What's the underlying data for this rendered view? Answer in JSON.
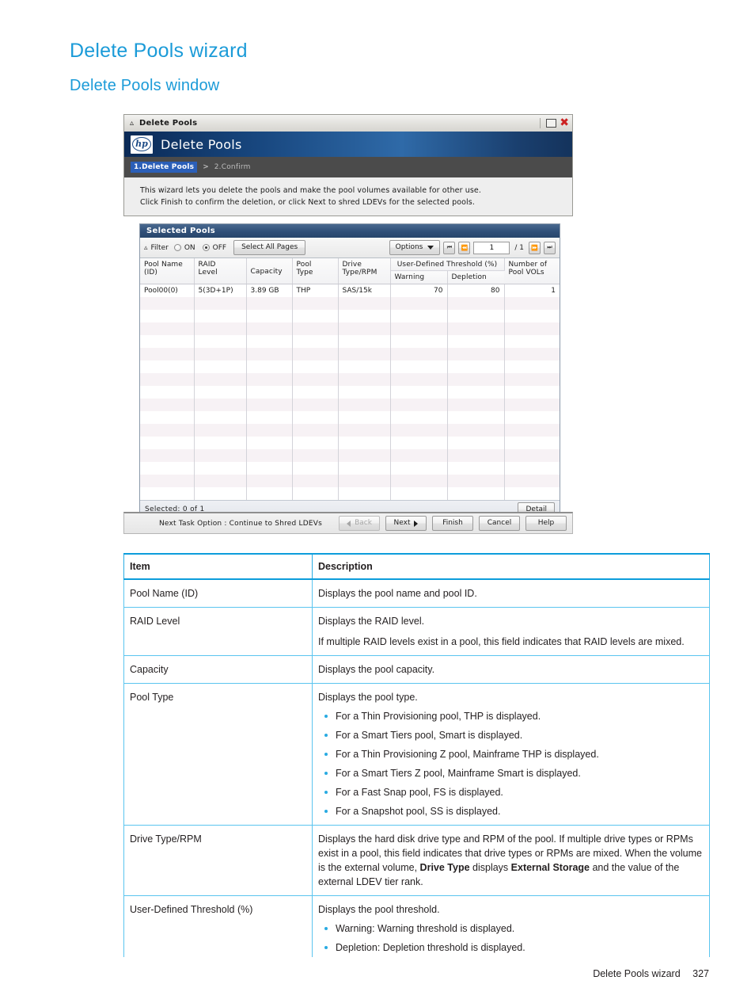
{
  "page": {
    "title": "Delete Pools wizard",
    "subtitle": "Delete Pools window",
    "footer_label": "Delete Pools wizard",
    "footer_page": "327",
    "accent_color": "#1b9bd8",
    "table_border_color": "#29abe2"
  },
  "dialog": {
    "titlebar": {
      "title": "Delete Pools",
      "collapse_icon": "chevron-up-icon",
      "maximize_icon": "maximize-icon",
      "close_icon": "close-icon"
    },
    "banner": {
      "logo": "hp-logo",
      "logo_text": "hp",
      "title": "Delete Pools"
    },
    "breadcrumb": {
      "step1": "1.Delete Pools",
      "separator": ">",
      "step2": "2.Confirm"
    },
    "description": {
      "line1": "This wizard lets you delete the pools and make the pool volumes available for other use.",
      "line2": "Click Finish to confirm the deletion, or click Next to shred LDEVs for the selected pools."
    },
    "panel": {
      "title": "Selected Pools",
      "toolbar": {
        "filter_icon": "filter-chevron-icon",
        "filter_label": "Filter",
        "radio_on_label": "ON",
        "radio_off_label": "OFF",
        "radio_selected": "OFF",
        "select_all_pages_label": "Select All Pages",
        "options_label": "Options",
        "options_caret": "caret-down-icon",
        "page_first_icon": "page-first-icon",
        "page_prev_icon": "page-prev-icon",
        "page_value": "1",
        "page_total": "/ 1",
        "page_next_icon": "page-next-icon",
        "page_last_icon": "page-last-icon"
      },
      "grid": {
        "group_header": "User-Defined Threshold (%)",
        "columns": [
          "Pool Name (ID)",
          "RAID Level",
          "Capacity",
          "Pool Type",
          "Drive Type/RPM",
          "Warning",
          "Depletion",
          "Number of Pool VOLs"
        ],
        "columns_line1": [
          "Pool Name",
          "RAID",
          "Capacity",
          "Pool",
          "Drive",
          "Warning",
          "Depletion",
          "Number of"
        ],
        "columns_line2": [
          "(ID)",
          "Level",
          "",
          "Type",
          "Type/RPM",
          "",
          "",
          "Pool VOLs"
        ],
        "rows": [
          {
            "pool_name": "Pool00(0)",
            "raid_level": "5(3D+1P)",
            "capacity": "3.89 GB",
            "pool_type": "THP",
            "drive_type_rpm": "SAS/15k",
            "warning": "70",
            "depletion": "80",
            "pool_vols": "1"
          }
        ],
        "empty_row_count": 16
      },
      "footer": {
        "selected_text": "Selected:  0   of  1",
        "detail_label": "Detail"
      }
    },
    "actionbar": {
      "next_task_option": "Next Task Option : Continue to Shred LDEVs",
      "back_label": "Back",
      "back_disabled": true,
      "next_label": "Next",
      "finish_label": "Finish",
      "cancel_label": "Cancel",
      "help_label": "Help"
    }
  },
  "desc_table": {
    "headers": [
      "Item",
      "Description"
    ],
    "rows": [
      {
        "item": "Pool Name (ID)",
        "paragraphs": [
          "Displays the pool name and pool ID."
        ],
        "bullets": []
      },
      {
        "item": "RAID Level",
        "paragraphs": [
          "Displays the RAID level.",
          "If multiple RAID levels exist in a pool, this field indicates that RAID levels are mixed."
        ],
        "bullets": []
      },
      {
        "item": "Capacity",
        "paragraphs": [
          "Displays the pool capacity."
        ],
        "bullets": []
      },
      {
        "item": "Pool Type",
        "paragraphs": [
          "Displays the pool type."
        ],
        "bullets": [
          "For a Thin Provisioning pool, THP is displayed.",
          "For a Smart Tiers pool, Smart is displayed.",
          "For a Thin Provisioning Z pool, Mainframe THP is displayed.",
          "For a Smart Tiers Z pool, Mainframe Smart is displayed.",
          "For a Fast Snap pool, FS is displayed.",
          "For a Snapshot pool, SS is displayed."
        ]
      },
      {
        "item": "Drive Type/RPM",
        "paragraphs": [],
        "rich": "drive_type_rich",
        "bullets": []
      },
      {
        "item": "User-Defined Threshold (%)",
        "paragraphs": [
          "Displays the pool threshold."
        ],
        "bullets": [
          "Warning: Warning threshold is displayed.",
          "Depletion: Depletion threshold is displayed."
        ]
      }
    ],
    "drive_type_rich": {
      "part1": "Displays the hard disk drive type and RPM of the pool. If multiple drive types or RPMs exist in a pool, this field indicates that drive types or RPMs are mixed. When the volume is the external volume, ",
      "bold1": "Drive Type",
      "part2": " displays ",
      "bold2": "External Storage",
      "part3": " and the value of the external LDEV tier rank."
    }
  }
}
